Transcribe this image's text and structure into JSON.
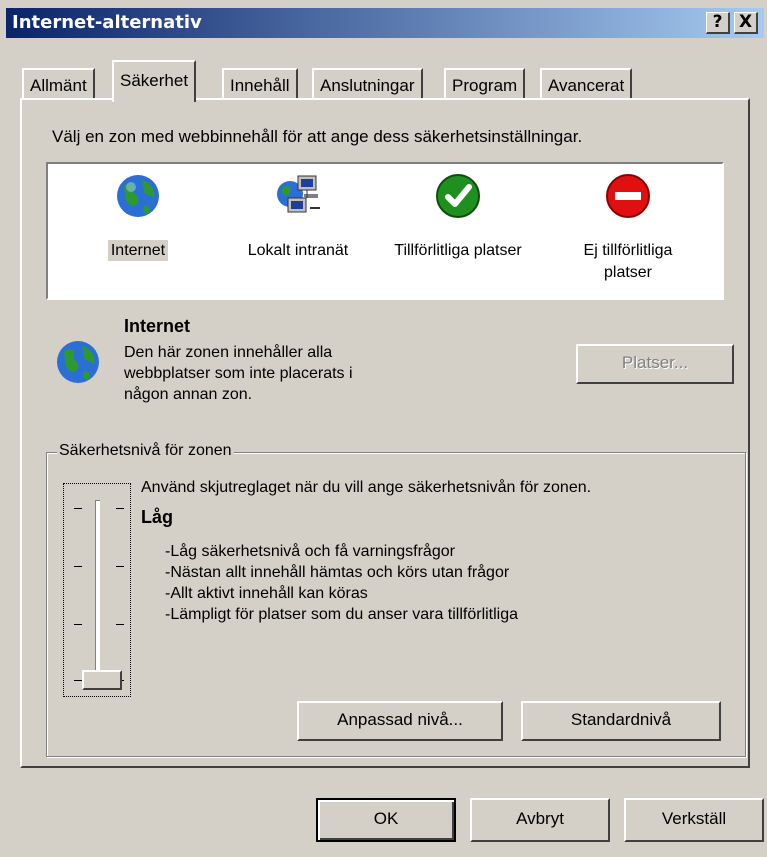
{
  "window": {
    "title": "Internet-alternativ",
    "help_label": "?",
    "close_label": "X"
  },
  "tabs": [
    "Allmänt",
    "Säkerhet",
    "Innehåll",
    "Anslutningar",
    "Program",
    "Avancerat"
  ],
  "active_tab": "Säkerhet",
  "zone_prompt": "Välj en zon med webbinnehåll för att ange dess säkerhetsinställningar.",
  "zones": [
    {
      "label": "Internet",
      "icon": "globe-icon"
    },
    {
      "label": "Lokalt intranät",
      "icon": "network-computers-icon"
    },
    {
      "label": "Tillförlitliga platser",
      "icon": "green-check-icon"
    },
    {
      "label": "Ej tillförlitliga platser",
      "icon": "red-block-icon"
    }
  ],
  "selected_zone": {
    "name": "Internet",
    "description_lines": [
      "Den här zonen innehåller alla",
      "webbplatser som inte placerats i",
      "någon annan zon."
    ],
    "sites_button": "Platser..."
  },
  "security_level": {
    "group_label": "Säkerhetsnivå för zonen",
    "slider_hint": "Använd skjutreglaget när du vill ange säkerhetsnivån för zonen.",
    "level_name": "Låg",
    "level_position": "lowest of 4",
    "details": [
      "-Låg säkerhetsnivå och få varningsfrågor",
      "-Nästan allt innehåll hämtas och körs utan frågor",
      "-Allt aktivt innehåll kan köras",
      "-Lämpligt för platser som du anser vara tillförlitliga"
    ],
    "custom_button": "Anpassad nivå...",
    "default_button": "Standardnivå"
  },
  "footer": {
    "ok": "OK",
    "cancel": "Avbryt",
    "apply": "Verkställ"
  },
  "colors": {
    "titlebar_start": "#0a246a",
    "titlebar_end": "#a6caf0",
    "face": "#d4d0c8"
  }
}
